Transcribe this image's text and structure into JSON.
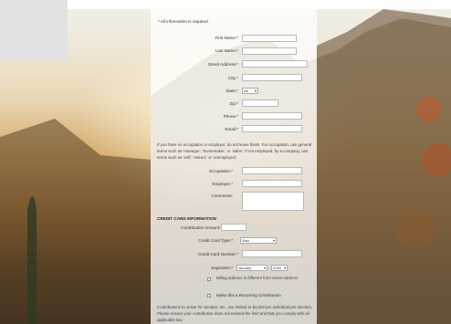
{
  "form": {
    "required_note": "* All information is required",
    "first_name_label": "First Name:*",
    "last_name_label": "Last Name:*",
    "street_label": "Street Address:*",
    "city_label": "City:*",
    "state_label": "State:*",
    "state_value": "AK",
    "zip_label": "Zip:*",
    "phone_label": "Phone:*",
    "email_label": "Email:*",
    "occupation_note": "If you have no occupation or employer, do not leave blank. For occupation, use general terms such as 'manager,' 'homemaker,' or 'sales.' If not employed, by a company, use terms such as 'self,' 'retired,' or 'unemployed'.",
    "occupation_label": "Occupation:*",
    "employer_label": "Employer:*",
    "comments_label": "Comments:",
    "cc_heading": "CREDIT CARD INFORMATION",
    "amount_label": "Contribution Amount:*",
    "card_type_label": "Credit Card Type:*",
    "card_type_value": "Visa",
    "card_number_label": "Credit Card Number:*",
    "expiration_label": "Expiration:*",
    "exp_month_value": "January",
    "exp_year_value": "2016",
    "billing_checkbox_label": "Billing address is different from street address",
    "recurring_checkbox_label": "Make this a Recurring Contribution",
    "footer_note": "Contributions to Jesse for Senator, Inc., are limited to $4,000 per individual per election. Please ensure your contribution does not exceed the limit and that you comply with all applicable law."
  },
  "colors": {
    "panel": "#ffffff",
    "sky": "#f2f0ea",
    "sunset": "#d4a868"
  }
}
